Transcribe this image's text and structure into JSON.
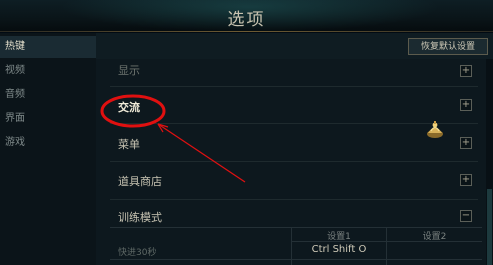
{
  "window": {
    "title": "选项"
  },
  "sidebar": {
    "items": [
      {
        "label": "热键",
        "active": true
      },
      {
        "label": "视频",
        "active": false
      },
      {
        "label": "音频",
        "active": false
      },
      {
        "label": "界面",
        "active": false
      },
      {
        "label": "游戏",
        "active": false
      }
    ]
  },
  "toolbar": {
    "reset_label": "恢复默认设置"
  },
  "sections": [
    {
      "label": "显示",
      "toggle": "+",
      "expanded": false
    },
    {
      "label": "交流",
      "toggle": "+",
      "expanded": false
    },
    {
      "label": "菜单",
      "toggle": "+",
      "expanded": false
    },
    {
      "label": "道具商店",
      "toggle": "+",
      "expanded": false
    },
    {
      "label": "训练模式",
      "toggle": "−",
      "expanded": true
    }
  ],
  "bindings_table": {
    "headers": [
      "设置1",
      "设置2"
    ],
    "rows": [
      {
        "action": "快进30秒",
        "setting1": "Ctrl Shift O",
        "setting2": ""
      }
    ]
  },
  "colors": {
    "accent_gold": "#c8aa6e",
    "annotation_red": "#e01010",
    "active_tab_bg": "#1a2b33"
  },
  "icons": {
    "ward": "golden-ward-icon",
    "expand": "plus-icon",
    "collapse": "minus-icon"
  }
}
